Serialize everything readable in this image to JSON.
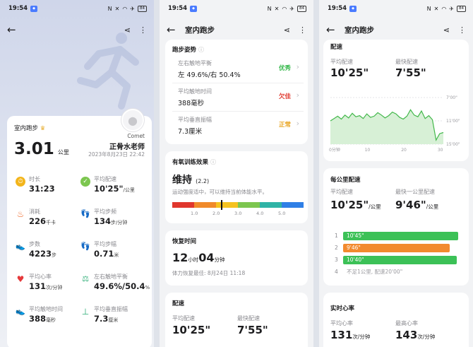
{
  "status": {
    "time": "19:54",
    "battery": "84"
  },
  "screen1": {
    "card_title": "室内跑步",
    "distance_value": "3.01",
    "distance_unit": "公里",
    "user_nick": "Comet",
    "user_name": "正骨水老师",
    "datetime": "2023年8月23日 22:42",
    "metrics": [
      {
        "key": "时长",
        "value": "31:23",
        "unit": ""
      },
      {
        "key": "平均配速",
        "value": "10'25\"",
        "unit": "/公里"
      },
      {
        "key": "消耗",
        "value": "226",
        "unit": "千卡"
      },
      {
        "key": "平均步频",
        "value": "134",
        "unit": "步/分钟"
      },
      {
        "key": "步数",
        "value": "4223",
        "unit": "步"
      },
      {
        "key": "平均步幅",
        "value": "0.71",
        "unit": "米"
      },
      {
        "key": "平均心率",
        "value": "131",
        "unit": "次/分钟"
      },
      {
        "key": "左右触地平衡",
        "value": "49.6%/50.4",
        "unit": "%"
      },
      {
        "key": "平均触地时间",
        "value": "388",
        "unit": "毫秒"
      },
      {
        "key": "平均垂直振幅",
        "value": "7.3",
        "unit": "厘米"
      }
    ]
  },
  "screen2": {
    "title": "室内跑步",
    "posture_title": "跑步姿势",
    "posture_rows": [
      {
        "key": "左右触地平衡",
        "value": "左 49.6%/右 50.4%",
        "status": "优秀",
        "color": "#34b84a"
      },
      {
        "key": "平均触地时间",
        "value": "388毫秒",
        "status": "欠佳",
        "color": "#e0372d"
      },
      {
        "key": "平均垂直振幅",
        "value": "7.3厘米",
        "status": "正常",
        "color": "#e8a21a"
      }
    ],
    "aerobic_title": "有氧训练效果",
    "aerobic_value": "维持",
    "aerobic_score": "(2.2)",
    "aerobic_desc": "运动强度适中，可以维持当前体能水平。",
    "scale_ticks": [
      "1.0",
      "2.0",
      "3.0",
      "4.0",
      "5.0"
    ],
    "aerobic_level": 2.2,
    "recovery_title": "恢复时间",
    "recovery_hours": "12",
    "recovery_hours_unit": "小时",
    "recovery_minutes": "04",
    "recovery_minutes_unit": "分钟",
    "recovery_note": "体力恢复最佳: 8月24日 11:18",
    "pace_title": "配速",
    "avg_pace_label": "平均配速",
    "avg_pace_value": "10'25\"",
    "fast_pace_label": "最快配速",
    "fast_pace_value": "7'55\""
  },
  "screen3": {
    "title": "室内跑步",
    "pace_title": "配速",
    "avg_pace_label": "平均配速",
    "avg_pace_value": "10'25\"",
    "fast_pace_label": "最快配速",
    "fast_pace_value": "7'55\"",
    "per_km_title": "每公里配速",
    "per_km_avg_label": "平均配速",
    "per_km_avg_value": "10'25\"",
    "per_km_avg_unit": "/公里",
    "per_km_fast_label": "最快一公里配速",
    "per_km_fast_value": "9'46\"",
    "per_km_fast_unit": "/公里",
    "km_rows": [
      {
        "n": "1",
        "label": "10'45\"",
        "color": "#3cc157",
        "frac": 0.97
      },
      {
        "n": "2",
        "label": "9'46\"",
        "color": "#f28a2e",
        "frac": 0.9
      },
      {
        "n": "3",
        "label": "10'40\"",
        "color": "#3cc157",
        "frac": 0.96
      },
      {
        "n": "4",
        "label": "不足1公里, 配速20'00\"",
        "color": "none",
        "frac": 0
      }
    ],
    "hr_title": "实时心率",
    "hr_avg_label": "平均心率",
    "hr_avg_value": "131",
    "hr_avg_unit": "次/分钟",
    "hr_max_label": "最高心率",
    "hr_max_value": "143",
    "hr_max_unit": "次/分钟"
  },
  "chart_data": {
    "type": "line",
    "x_ticks": [
      "0分钟",
      "10",
      "20",
      "30"
    ],
    "y_ticks": [
      "7'00\"",
      "11'00\"",
      "15'00\""
    ],
    "xlim": [
      0,
      31
    ],
    "ylim": [
      7,
      15
    ],
    "y_inverted": true,
    "x": [
      0,
      1,
      2,
      3,
      4,
      5,
      6,
      7,
      8,
      9,
      10,
      11,
      12,
      13,
      14,
      15,
      16,
      17,
      18,
      19,
      20,
      21,
      22,
      23,
      24,
      25,
      26,
      27,
      28,
      29,
      30,
      31
    ],
    "y": [
      11.0,
      10.6,
      10.2,
      10.7,
      10.0,
      10.5,
      9.7,
      10.3,
      10.1,
      10.6,
      9.8,
      10.4,
      10.2,
      9.6,
      10.0,
      10.5,
      10.1,
      9.5,
      9.8,
      10.4,
      10.7,
      10.2,
      9.1,
      10.0,
      10.3,
      9.3,
      10.6,
      10.1,
      10.8,
      14.3,
      13.2,
      13.0
    ]
  }
}
